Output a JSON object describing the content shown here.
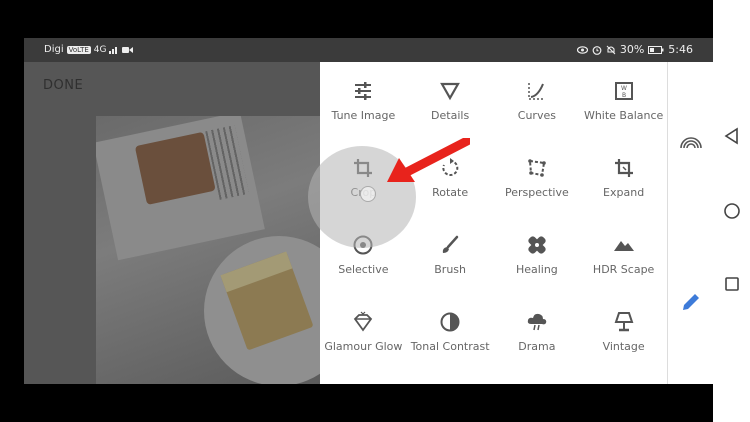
{
  "status_bar": {
    "carrier": "Digi",
    "volte": "VoLTE",
    "network": "4G",
    "battery": "30%",
    "time": "5:46",
    "icons": [
      "eye-icon",
      "alarm-icon",
      "mute-icon",
      "battery-icon",
      "video-icon",
      "signal-icon"
    ]
  },
  "editor": {
    "done_label": "DONE"
  },
  "tools": [
    {
      "label": "Tune Image",
      "icon": "tune-icon"
    },
    {
      "label": "Details",
      "icon": "details-triangle-icon"
    },
    {
      "label": "Curves",
      "icon": "curves-icon"
    },
    {
      "label": "White Balance",
      "icon": "white-balance-icon"
    },
    {
      "label": "Crop",
      "icon": "crop-icon"
    },
    {
      "label": "Rotate",
      "icon": "rotate-icon"
    },
    {
      "label": "Perspective",
      "icon": "perspective-icon"
    },
    {
      "label": "Expand",
      "icon": "expand-icon"
    },
    {
      "label": "Selective",
      "icon": "selective-icon"
    },
    {
      "label": "Brush",
      "icon": "brush-icon"
    },
    {
      "label": "Healing",
      "icon": "healing-icon"
    },
    {
      "label": "HDR Scape",
      "icon": "hdr-mountain-icon"
    },
    {
      "label": "Glamour Glow",
      "icon": "glamour-diamond-icon"
    },
    {
      "label": "Tonal Contrast",
      "icon": "tonal-contrast-icon"
    },
    {
      "label": "Drama",
      "icon": "drama-cloud-icon"
    },
    {
      "label": "Vintage",
      "icon": "vintage-lamp-icon"
    }
  ],
  "sidebar": {
    "icons": [
      "styles-arc-icon",
      "edit-pencil-icon"
    ],
    "accent": "#3d7bd9"
  },
  "navbar": {
    "icons": [
      "back-triangle-icon",
      "home-circle-icon",
      "recents-square-icon"
    ]
  },
  "annotation": {
    "arrow_color": "#e8231c"
  }
}
